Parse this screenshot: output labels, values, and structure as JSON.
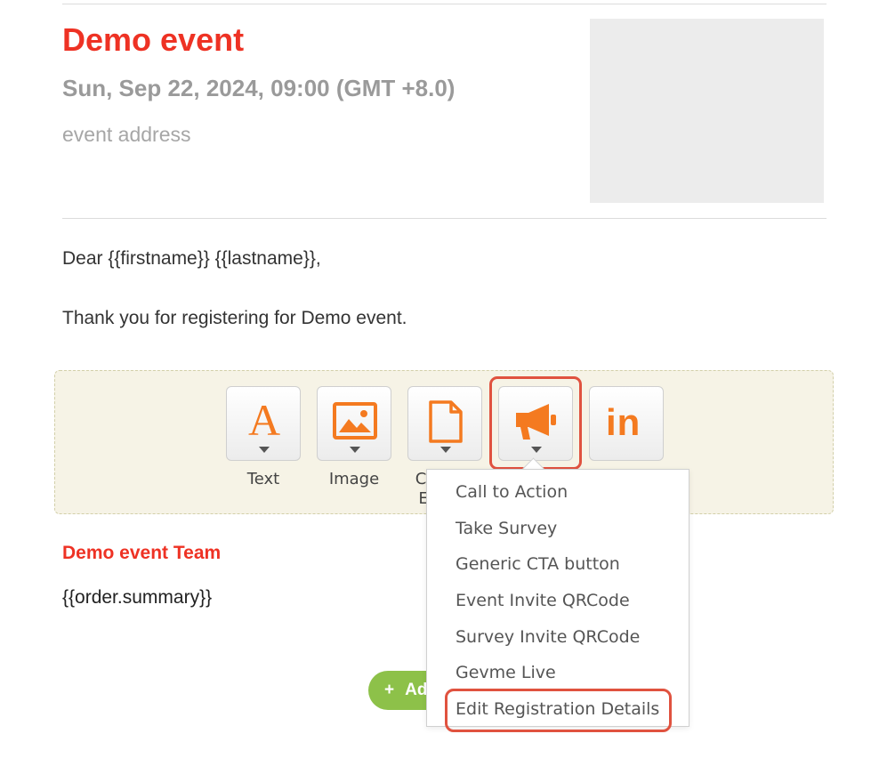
{
  "event": {
    "title": "Demo event",
    "datetime": "Sun, Sep 22, 2024, 09:00 (GMT +8.0)",
    "address": "event address"
  },
  "body": {
    "greeting": "Dear {{firstname}} {{lastname}},",
    "thanks": "Thank you for registering for Demo event."
  },
  "toolbar": {
    "text_label": "Text",
    "image_label": "Image",
    "content_label_partial": "C",
    "content_label_partial_2": "E"
  },
  "footer": {
    "team": "Demo event Team",
    "summary": "{{order.summary}}",
    "add_label": "Ad"
  },
  "dropdown": {
    "items": [
      "Call to Action",
      "Take Survey",
      "Generic CTA button",
      "Event Invite QRCode",
      "Survey Invite QRCode",
      "Gevme Live",
      "Edit Registration Details"
    ]
  },
  "colors": {
    "brand_red": "#ee3224",
    "icon_orange": "#f47a20",
    "add_green": "#8dc149",
    "highlight": "#e0523f"
  }
}
